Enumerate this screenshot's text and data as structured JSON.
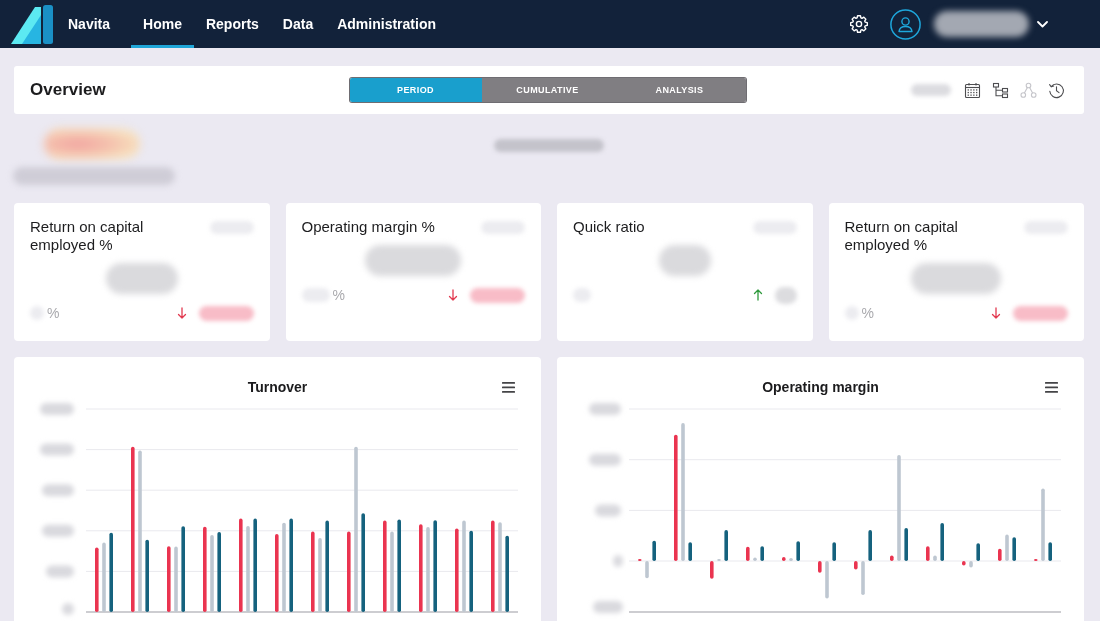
{
  "navbar": {
    "brand": "Navita",
    "tabs": [
      {
        "label": "Home",
        "selected": true
      },
      {
        "label": "Reports",
        "selected": false
      },
      {
        "label": "Data",
        "selected": false
      },
      {
        "label": "Administration",
        "selected": false
      }
    ]
  },
  "overview": {
    "title": "Overview",
    "views": [
      {
        "label": "PERIOD",
        "selected": true
      },
      {
        "label": "CUMULATIVE",
        "selected": false
      },
      {
        "label": "ANALYSIS",
        "selected": false
      }
    ],
    "tools": [
      {
        "kind": "calendar",
        "disabled": false
      },
      {
        "kind": "tree",
        "disabled": false
      },
      {
        "kind": "network",
        "disabled": true
      },
      {
        "kind": "history",
        "disabled": false
      }
    ]
  },
  "kpis": [
    {
      "title": "Return on capital employed %",
      "unit": "%",
      "rising": false
    },
    {
      "title": "Operating margin %",
      "unit": "%",
      "rising": false
    },
    {
      "title": "Quick ratio",
      "rising": true
    },
    {
      "title": "Return on capital employed %",
      "unit": "%",
      "rising": false
    }
  ],
  "charts": [
    {
      "title": "Turnover"
    },
    {
      "title": "Operating margin"
    }
  ]
}
